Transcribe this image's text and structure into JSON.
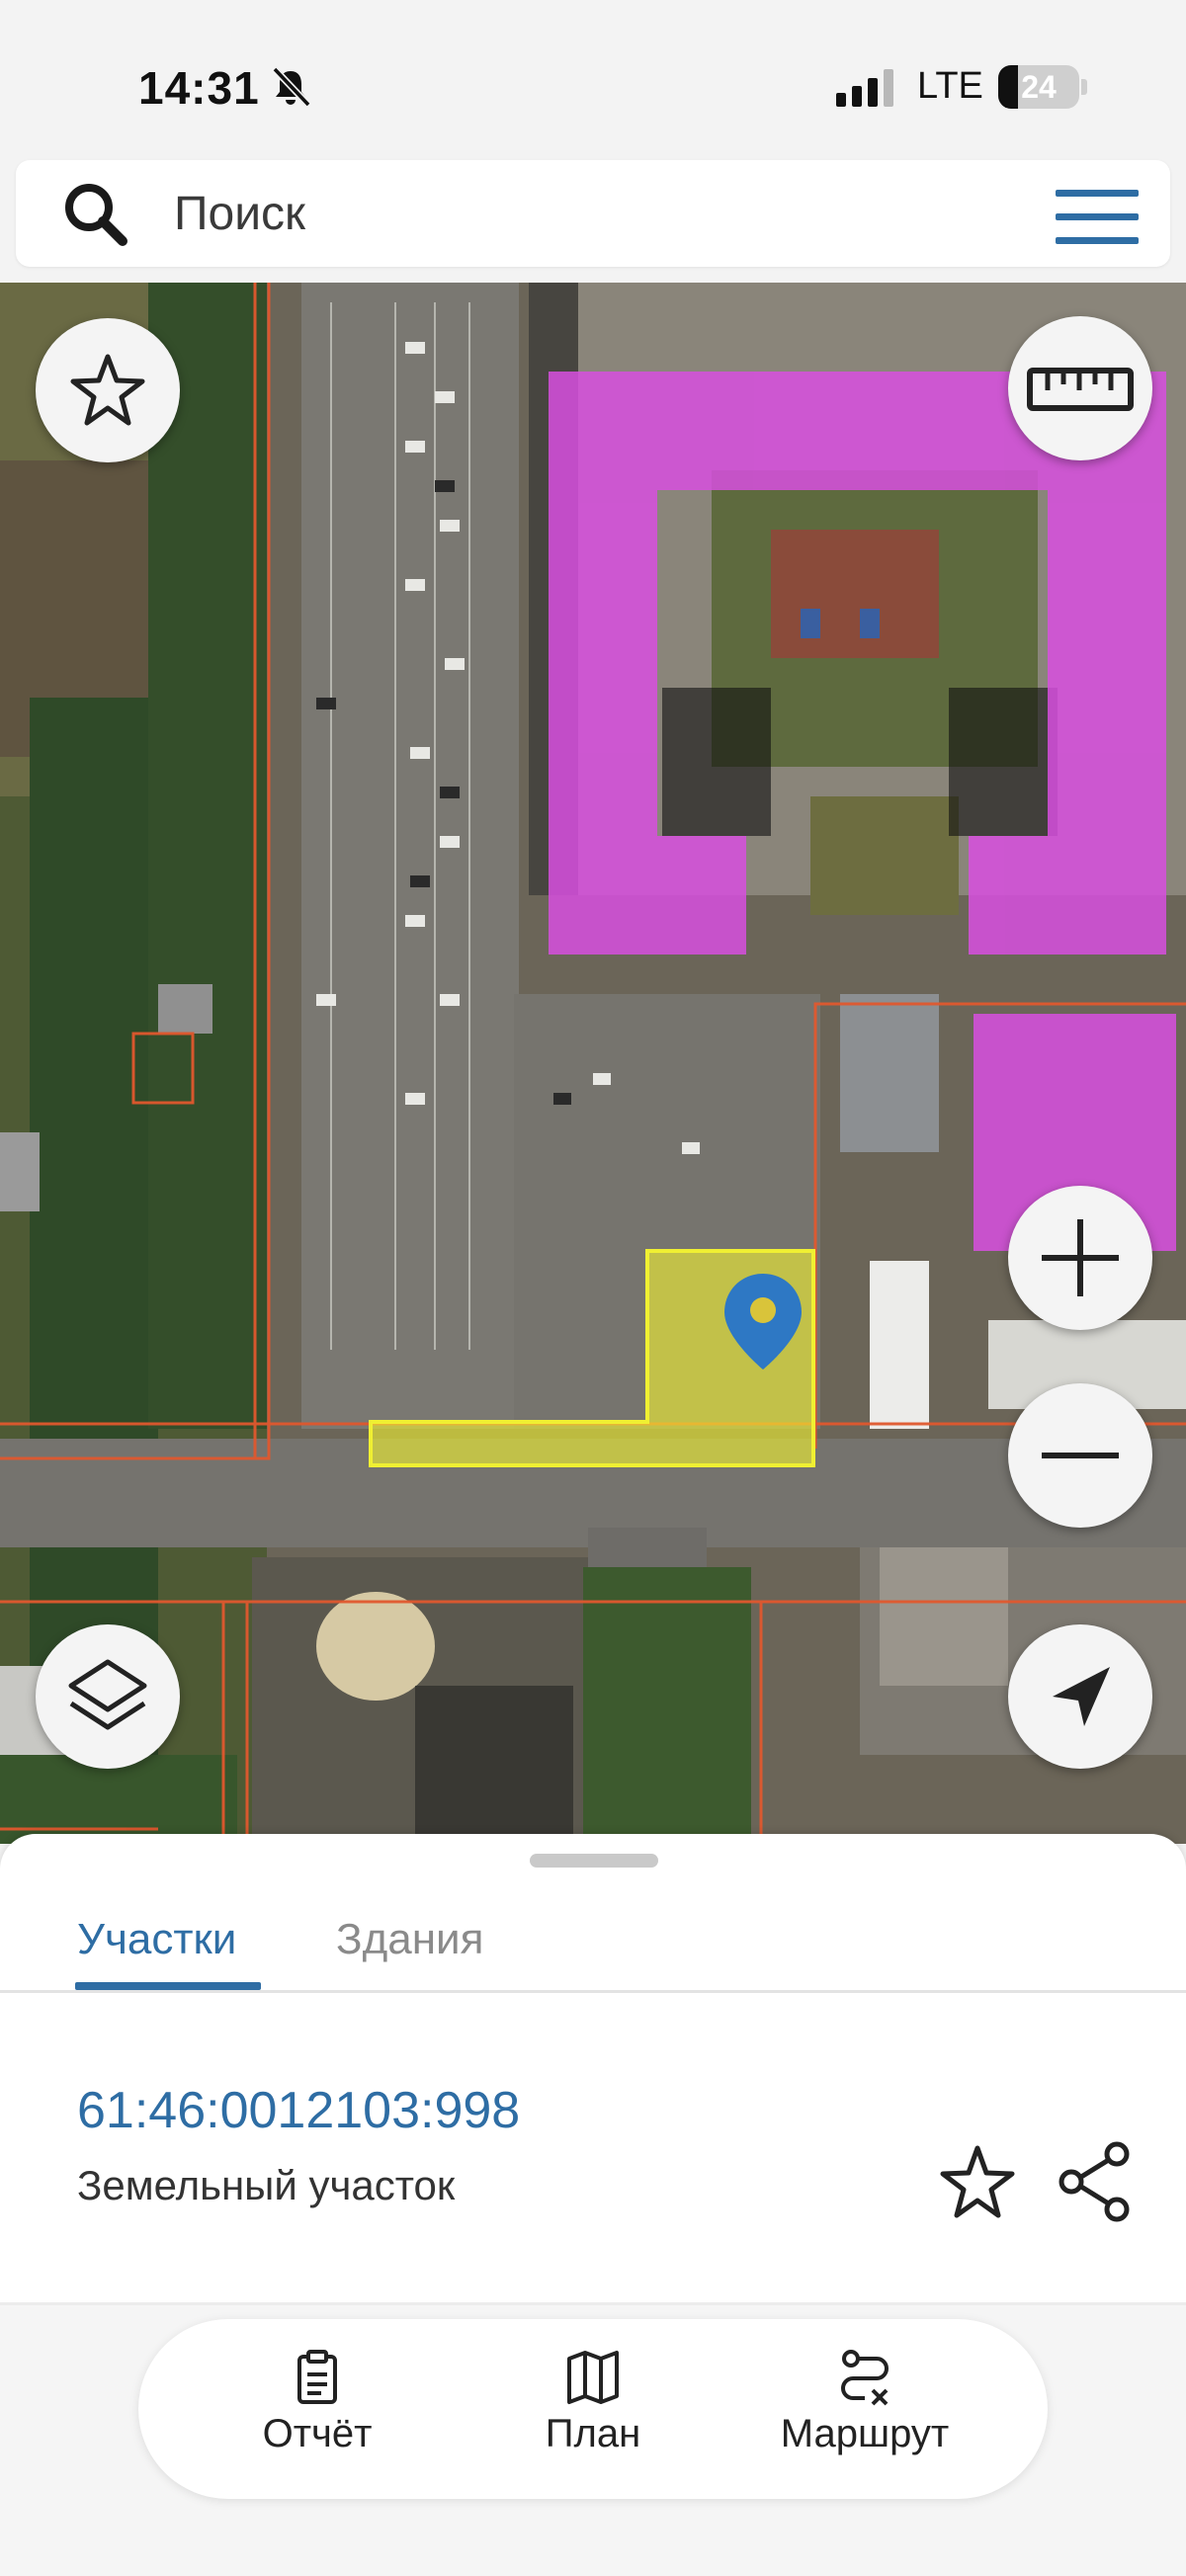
{
  "status_bar": {
    "time": "14:31",
    "network": "LTE",
    "battery": "24",
    "battery_level_percent": 24
  },
  "search": {
    "placeholder": "Поиск"
  },
  "colors": {
    "accent": "#2e6da4",
    "selected_parcel": "#f0f032",
    "building_overlay": "#d84fe0",
    "parcel_border": "#e0582e",
    "pin": "#2e78c4"
  },
  "map": {
    "buttons": {
      "favorites_icon": "star-icon",
      "ruler_icon": "ruler-icon",
      "zoom_in_icon": "plus-icon",
      "zoom_out_icon": "minus-icon",
      "layers_icon": "layers-icon",
      "locate_icon": "navigation-arrow-icon"
    }
  },
  "sheet": {
    "tabs": [
      {
        "label": "Участки",
        "active": true
      },
      {
        "label": "Здания",
        "active": false
      }
    ],
    "parcel": {
      "cadastral_number": "61:46:0012103:998",
      "type": "Земельный участок"
    }
  },
  "bottom_nav": {
    "items": [
      {
        "label": "Отчёт",
        "icon": "clipboard-icon"
      },
      {
        "label": "План",
        "icon": "map-icon"
      },
      {
        "label": "Маршрут",
        "icon": "route-icon"
      }
    ]
  }
}
